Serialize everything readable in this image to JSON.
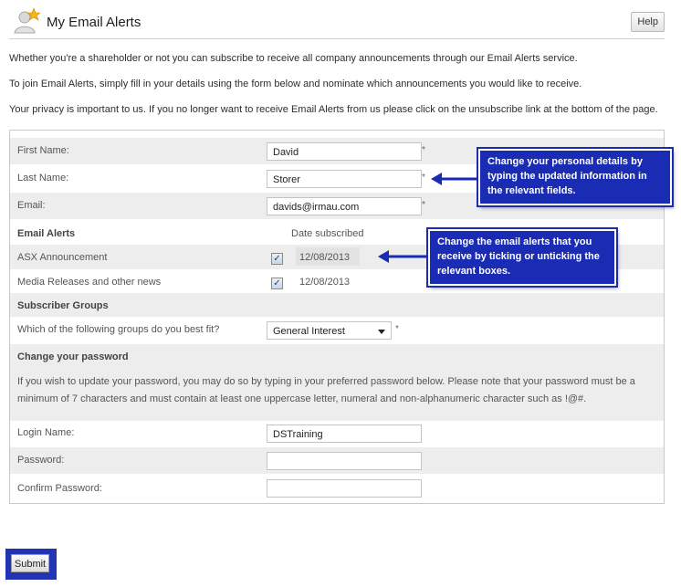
{
  "header": {
    "title": "My Email Alerts",
    "help_label": "Help"
  },
  "intro": [
    "Whether you're a shareholder or not you can subscribe to receive all company announcements through our Email Alerts service.",
    "To join Email Alerts, simply fill in your details using the form below and nominate which announcements you would like to receive.",
    "Your privacy is important to us. If you no longer want to receive Email Alerts from us please click on the unsubscribe link at the bottom of the page."
  ],
  "personal": {
    "first_name_label": "First Name:",
    "first_name_value": "David",
    "last_name_label": "Last Name:",
    "last_name_value": "Storer",
    "email_label": "Email:",
    "email_value": "davids@irmau.com",
    "required_mark": "*"
  },
  "alerts": {
    "heading": "Email Alerts",
    "date_header": "Date subscribed",
    "items": [
      {
        "label": "ASX Announcement",
        "checked": true,
        "date": "12/08/2013"
      },
      {
        "label": "Media Releases and other news",
        "checked": true,
        "date": "12/08/2013"
      }
    ]
  },
  "groups": {
    "heading": "Subscriber Groups",
    "question": "Which of the following groups do you best fit?",
    "selected": "General Interest",
    "required_mark": "*"
  },
  "password": {
    "heading": "Change your password",
    "description": "If you wish to update your password, you may do so by typing in your preferred password below. Please note that your password must be a minimum of 7 characters and must contain at least one uppercase letter, numeral and non-alphanumeric character such as !@#.",
    "login_label": "Login Name:",
    "login_value": "DSTraining",
    "password_label": "Password:",
    "password_value": "",
    "confirm_label": "Confirm Password:",
    "confirm_value": ""
  },
  "callouts": {
    "personal": "Change your personal details by typing the updated information in the relevant fields.",
    "alerts": "Change the email alerts that you receive by ticking or unticking the relevant boxes."
  },
  "submit_label": "Submit",
  "colors": {
    "callout": "#1a2bb4",
    "row_shade": "#ededed"
  },
  "icons": [
    "user-star-icon",
    "checkbox-icon",
    "chevron-down-icon",
    "arrow-left-icon"
  ]
}
